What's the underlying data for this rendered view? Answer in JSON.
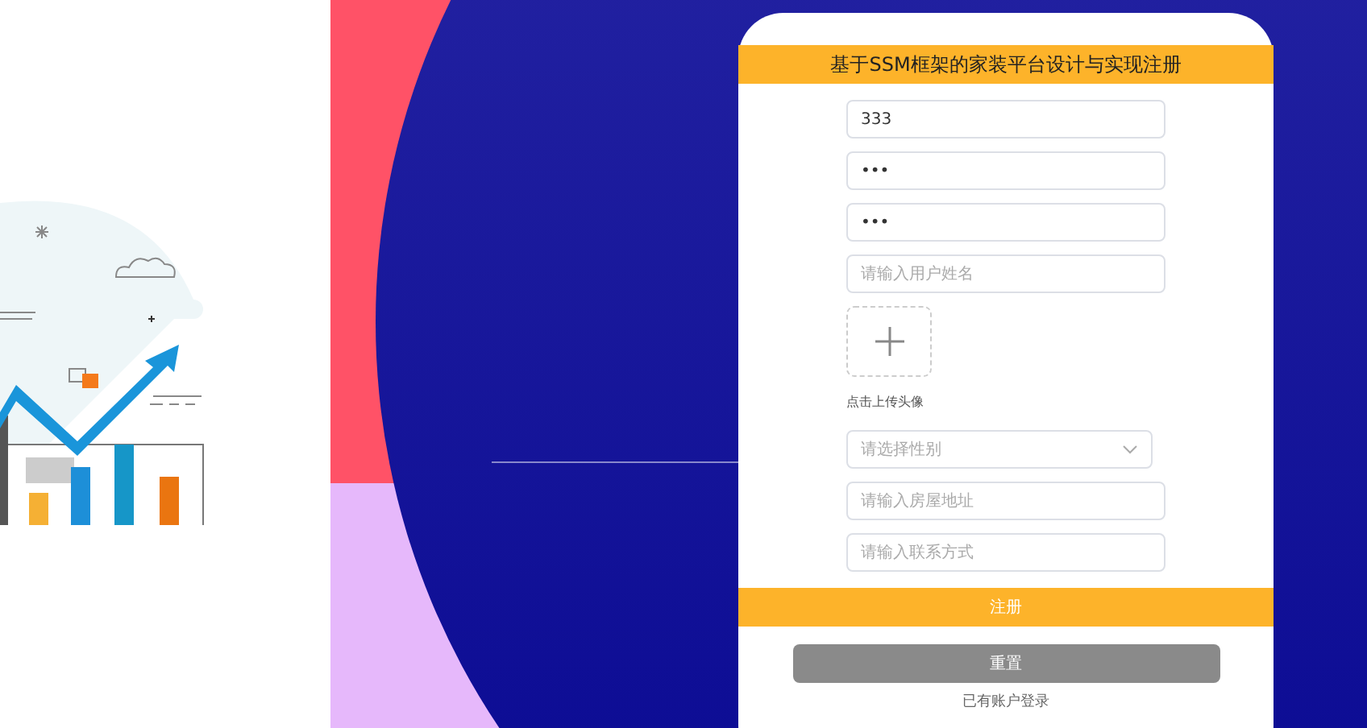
{
  "title": "基于SSM框架的家装平台设计与实现注册",
  "fields": [
    {
      "kind": "input",
      "value": "333"
    },
    {
      "kind": "input",
      "value": "•••"
    },
    {
      "kind": "input",
      "value": "•••"
    },
    {
      "kind": "input",
      "placeholder": "请输入用户姓名"
    },
    {
      "kind": "upload",
      "label": "点击上传头像"
    },
    {
      "kind": "select",
      "placeholder": "请选择性别"
    },
    {
      "kind": "input",
      "placeholder": "请输入房屋地址"
    },
    {
      "kind": "input",
      "placeholder": "请输入联系方式"
    }
  ],
  "register_button": "注册",
  "reset_button": "重置",
  "login_link": "已有账户登录"
}
